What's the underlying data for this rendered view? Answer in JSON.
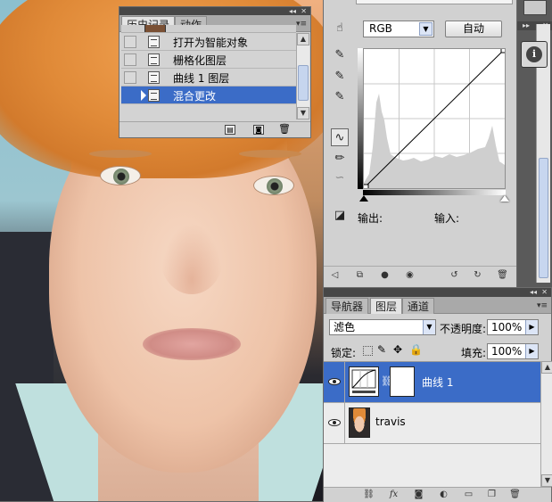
{
  "history_panel": {
    "tabs": [
      "历史记录",
      "动作"
    ],
    "active_tab": 0,
    "items": [
      {
        "label": "打开为智能对象",
        "selected": false
      },
      {
        "label": "栅格化图层",
        "selected": false
      },
      {
        "label": "曲线 1 图层",
        "selected": false
      },
      {
        "label": "混合更改",
        "selected": true
      }
    ]
  },
  "adjustments_panel": {
    "channel": "RGB",
    "auto_label": "自动",
    "output_label": "输出:",
    "input_label": "输入:"
  },
  "layers_panel": {
    "tabs": [
      "导航器",
      "图层",
      "通道"
    ],
    "active_tab": 1,
    "blend_mode": "滤色",
    "opacity_label": "不透明度:",
    "opacity_value": "100%",
    "lock_label": "锁定:",
    "fill_label": "填充:",
    "fill_value": "100%",
    "layers": [
      {
        "name": "曲线 1",
        "type": "adjustment",
        "selected": true
      },
      {
        "name": "travis",
        "type": "image",
        "selected": false
      }
    ]
  },
  "colors": {
    "selection": "#3b6cc7",
    "panel_bg": "#d1d1d1",
    "panel_header": "#474747"
  },
  "icons": {
    "history_bottom": [
      "new-document-icon",
      "camera-icon",
      "trash-icon"
    ],
    "adjustment_tools": [
      "hand-adjust-icon",
      "eyedropper-black-icon",
      "eyedropper-gray-icon",
      "eyedropper-white-icon",
      "curve-point-icon",
      "pencil-icon",
      "smooth-icon",
      "clipping-warning-icon"
    ],
    "adjustment_bottom": [
      "back-arrow-icon",
      "expand-view-icon",
      "clip-layer-icon",
      "visibility-icon",
      "view-previous-icon",
      "reset-icon",
      "trash-icon"
    ],
    "layers_bottom": [
      "link-icon",
      "fx-icon",
      "add-mask-icon",
      "adjustment-layer-icon",
      "group-folder-icon",
      "new-layer-icon",
      "trash-icon"
    ]
  }
}
